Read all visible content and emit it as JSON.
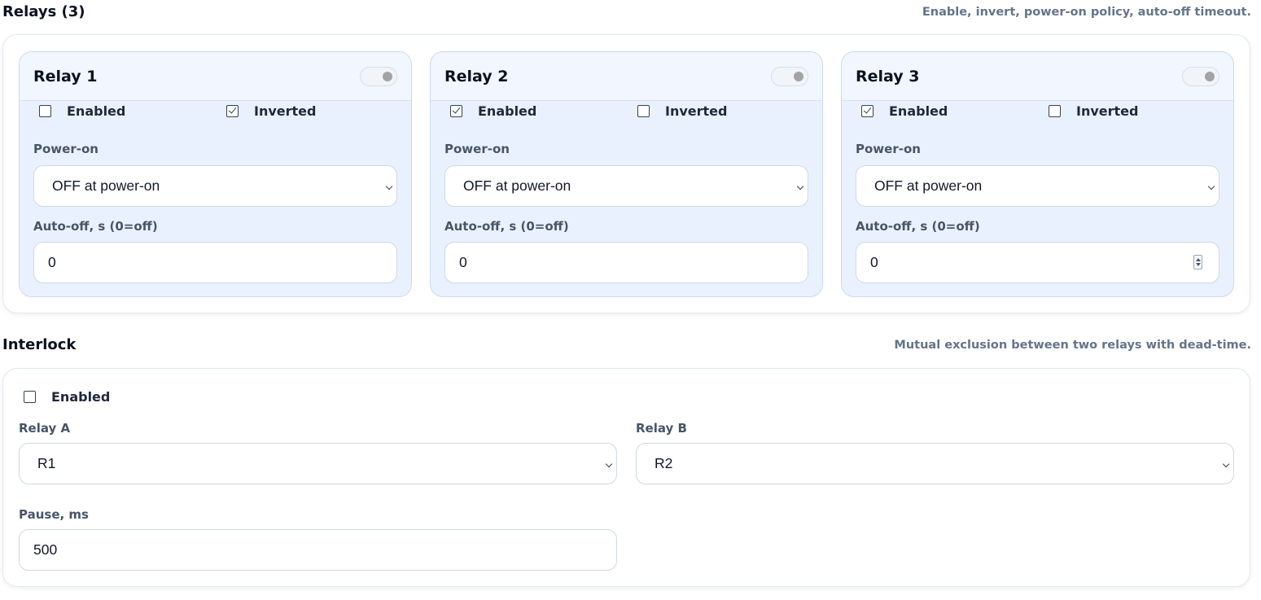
{
  "relays_section": {
    "title": "Relays (3)",
    "hint": "Enable, invert, power-on policy, auto-off timeout.",
    "relays": [
      {
        "title": "Relay 1",
        "toggle_on": false,
        "enabled_label": "Enabled",
        "enabled": false,
        "inverted_label": "Inverted",
        "inverted": true,
        "power_on_label": "Power-on",
        "power_on_value": "OFF at power-on",
        "auto_off_label": "Auto-off, s (0=off)",
        "auto_off_value": "0"
      },
      {
        "title": "Relay 2",
        "toggle_on": false,
        "enabled_label": "Enabled",
        "enabled": true,
        "inverted_label": "Inverted",
        "inverted": false,
        "power_on_label": "Power-on",
        "power_on_value": "OFF at power-on",
        "auto_off_label": "Auto-off, s (0=off)",
        "auto_off_value": "0"
      },
      {
        "title": "Relay 3",
        "toggle_on": false,
        "enabled_label": "Enabled",
        "enabled": true,
        "inverted_label": "Inverted",
        "inverted": false,
        "power_on_label": "Power-on",
        "power_on_value": "OFF at power-on",
        "auto_off_label": "Auto-off, s (0=off)",
        "auto_off_value": "0"
      }
    ]
  },
  "interlock_section": {
    "title": "Interlock",
    "hint": "Mutual exclusion between two relays with dead-time.",
    "enabled_label": "Enabled",
    "enabled": false,
    "relay_a_label": "Relay A",
    "relay_a_value": "R1",
    "relay_b_label": "Relay B",
    "relay_b_value": "R2",
    "pause_label": "Pause, ms",
    "pause_value": "500"
  }
}
